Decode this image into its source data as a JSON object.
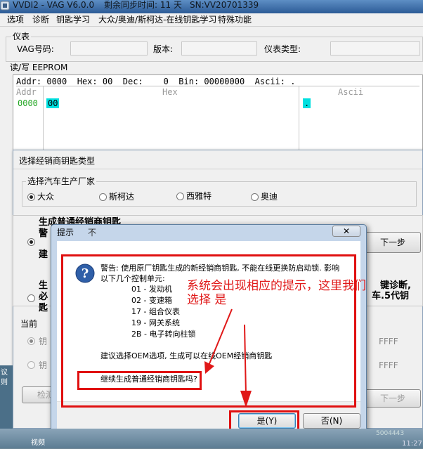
{
  "window": {
    "title": "VVDI2 - VAG V6.0.0",
    "sync_label": "剩余同步时间: 11 天",
    "serial": "SN:VV20701339"
  },
  "menu": [
    "选项",
    "诊断",
    "钥匙学习",
    "大众/奥迪/斯柯达-在线钥匙学习",
    "特殊功能"
  ],
  "instrument": {
    "group_title": "仪表",
    "vag_label": "VAG号码:",
    "version_label": "版本:",
    "type_label": "仪表类型:"
  },
  "eeprom": {
    "group_title": "读/写 EEPROM",
    "addr_label": "Addr:",
    "addr_value": "0000",
    "hex_label": "Hex:",
    "hex_value": "00",
    "dec_label": "Dec:",
    "dec_value": "0",
    "bin_label": "Bin:",
    "bin_value": "00000000",
    "ascii_label": "Ascii:",
    "ascii_value": ".",
    "col_addr": "Addr",
    "col_hex": "Hex",
    "col_ascii": "Ascii",
    "row_addr": "0000",
    "row_hex": "00",
    "row_ascii": "."
  },
  "dealer_dialog": {
    "title": "选择经销商钥匙类型",
    "manufacturer_group": "选择汽车生产厂家",
    "brands": [
      "大众",
      "斯柯达",
      "西雅特",
      "奥迪"
    ],
    "selected_brand": "大众",
    "option1_title": "生成普通经销商钥匙",
    "option1_l2": "警",
    "option1_l3": "建",
    "next_button": "下一步",
    "option2_l1": "生",
    "option2_l2": "必",
    "option2_l3": "匙",
    "option2_right_1": "键诊断,",
    "option2_right_2": "车.5代钥",
    "current_group": "当前",
    "cur_l1": "钥",
    "cur_l2": "钥",
    "ffff_1": "FFFF",
    "ffff_2": "FFFF",
    "detect_button": "检测原",
    "next_button_2": "下一步"
  },
  "prompt": {
    "title": "提示",
    "behind_text": "不",
    "warning_line1": "警告: 使用原厂钥匙生成的新经销商钥匙, 不能在线更换防启动锁. 影响",
    "warning_line2": "以下几个控制单元:",
    "units": [
      "01 - 发动机",
      "02 - 变速箱",
      "17 - 组合仪表",
      "19 - 网关系统",
      "2B - 电子转向柱锁"
    ],
    "recommend": "建议选择OEM选项, 生成可以在线OEM经销商钥匙",
    "question": "继续生成普通经销商钥匙吗?",
    "yes_button": "是(Y)",
    "no_button": "否(N)"
  },
  "annotation": {
    "line1": "系统会出现相应的提示，这里我们",
    "line2": "选择    是",
    "color": "#e01818"
  },
  "desktop": {
    "left_label": "议则",
    "bottom_left": "视频",
    "clock": "11:27",
    "code_fragment": "5004443"
  }
}
